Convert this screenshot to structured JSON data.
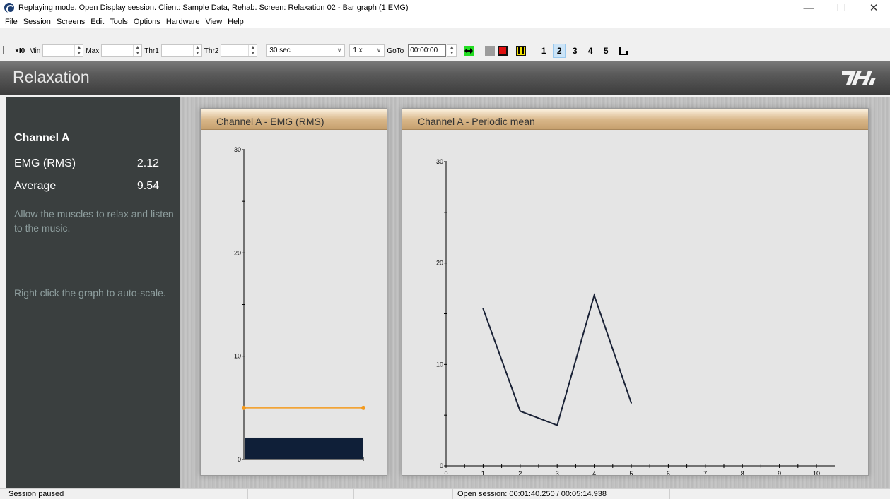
{
  "window": {
    "title": "Replaying mode. Open Display session. Client: Sample Data, Rehab. Screen: Relaxation 02 - Bar graph (1 EMG)",
    "minimize": "—",
    "maximize": "☐",
    "close": "✕"
  },
  "menu": [
    "File",
    "Session",
    "Screens",
    "Edit",
    "Tools",
    "Options",
    "Hardware",
    "View",
    "Help"
  ],
  "toolbar": {
    "x10": "×I0",
    "min_label": "Min",
    "max_label": "Max",
    "thr1_label": "Thr1",
    "thr2_label": "Thr2",
    "timebase": "30 sec",
    "speed": "1 x",
    "goto_label": "GoTo",
    "goto_time": "00:00:00",
    "screens": [
      "1",
      "2",
      "3",
      "4",
      "5"
    ],
    "active_screen": "2"
  },
  "header": {
    "title": "Relaxation"
  },
  "left": {
    "channel": "Channel A",
    "emg_label": "EMG (RMS)",
    "emg_value": "2.12",
    "avg_label": "Average",
    "avg_value": "9.54",
    "hint1": "Allow the muscles to relax and listen to the music.",
    "hint2": "Right click the graph to auto-scale."
  },
  "bar_panel": {
    "title": "Channel A - EMG (RMS)"
  },
  "line_panel": {
    "title": "Channel A - Periodic mean"
  },
  "chart_data": [
    {
      "type": "bar",
      "title": "Channel A - EMG (RMS)",
      "ylim": [
        0,
        30
      ],
      "yticks": [
        0,
        10,
        20,
        30
      ],
      "values": [
        2.12
      ],
      "threshold": 5,
      "colors": {
        "bar": "#0f1f38",
        "threshold": "#f39a1e"
      }
    },
    {
      "type": "line",
      "title": "Channel A - Periodic mean",
      "x": [
        1,
        2,
        3,
        4,
        5
      ],
      "y": [
        15.5,
        5.4,
        4.0,
        16.8,
        6.2
      ],
      "xlim": [
        0,
        10
      ],
      "ylim": [
        0,
        30
      ],
      "xticks": [
        0,
        1,
        2,
        3,
        4,
        5,
        6,
        7,
        8,
        9,
        10
      ],
      "yticks": [
        0,
        10,
        20,
        30
      ],
      "colors": {
        "line": "#1a2236"
      }
    }
  ],
  "status": {
    "left": "Session paused",
    "middle": "Open session: 00:01:40.250 / 00:05:14.938"
  }
}
